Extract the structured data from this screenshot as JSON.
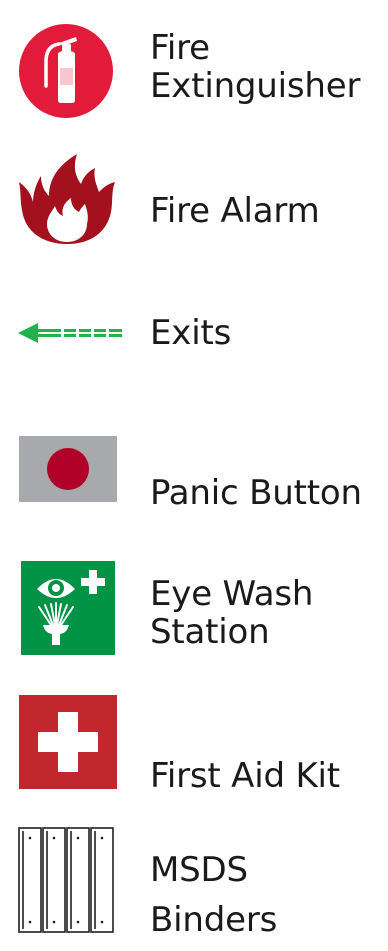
{
  "legend": {
    "items": [
      {
        "id": "fire-extinguisher",
        "label_line1": "Fire",
        "label_line2": "Extinguisher",
        "icon": "fire-extinguisher-icon",
        "color": "#E31B3B"
      },
      {
        "id": "fire-alarm",
        "label_line1": "Fire Alarm",
        "icon": "flame-icon",
        "color": "#A3111E"
      },
      {
        "id": "exits",
        "label_line1": "Exits",
        "icon": "exit-arrow-icon",
        "color": "#22B14C"
      },
      {
        "id": "panic-button",
        "label_line1": "Panic Button",
        "icon": "panic-button-icon",
        "color": "#B0002A",
        "background": "#A7A9AC"
      },
      {
        "id": "eye-wash",
        "label_line1": "Eye Wash",
        "label_line2": "Station",
        "icon": "eye-wash-icon",
        "color": "#009245"
      },
      {
        "id": "first-aid",
        "label_line1": "First Aid Kit",
        "icon": "first-aid-cross-icon",
        "color": "#C1272D"
      },
      {
        "id": "msds",
        "label_line1": "MSDS",
        "label_line2": "Binders",
        "icon": "binders-icon",
        "color": "#231F20"
      }
    ]
  }
}
